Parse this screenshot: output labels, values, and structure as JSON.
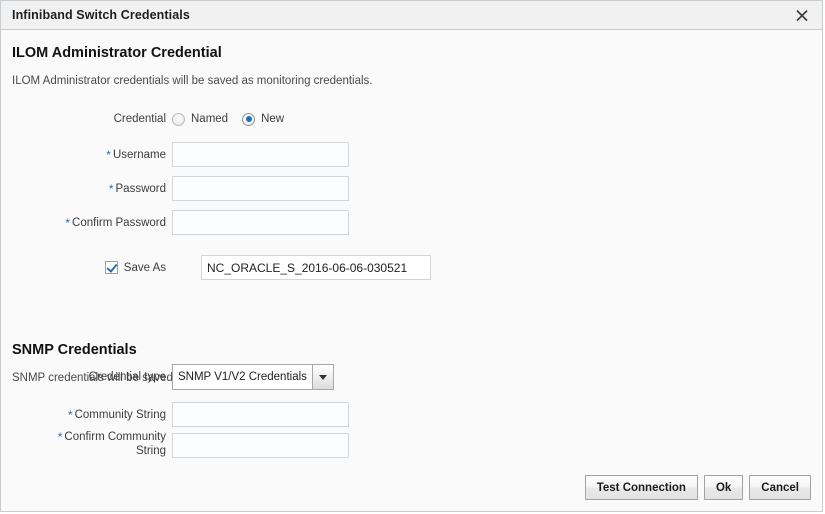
{
  "dialog": {
    "title": "Infiniband Switch Credentials",
    "close_icon": "close-icon"
  },
  "ilom": {
    "heading": "ILOM Administrator Credential",
    "description": "ILOM Administrator credentials will be saved as monitoring credentials.",
    "credential_label": "Credential",
    "radio_named": "Named",
    "radio_new": "New",
    "selected_credential": "New",
    "username_label": "Username",
    "username_value": "",
    "password_label": "Password",
    "password_value": "",
    "confirm_password_label": "Confirm Password",
    "confirm_password_value": "",
    "save_as_label": "Save As",
    "save_as_checked": true,
    "save_as_value": "NC_ORACLE_S_2016-06-06-030521",
    "required_marker": "*"
  },
  "snmp": {
    "heading": "SNMP Credentials",
    "description": "SNMP credentials will be saved as monitoring credentials.",
    "credential_type_label": "Credential type",
    "credential_type_value": "SNMP V1/V2 Credentials",
    "community_string_label": "Community String",
    "community_string_value": "",
    "confirm_community_string_label_line1": "Confirm Community",
    "confirm_community_string_label_line2": "String",
    "confirm_community_string_value": "",
    "required_marker": "*"
  },
  "footer": {
    "test_connection": "Test Connection",
    "ok": "Ok",
    "cancel": "Cancel"
  },
  "colors": {
    "accent": "#1e6fb8",
    "required": "#2f6fb5",
    "titlebar_bg": "#f1f1f1",
    "body_bg": "#fafafa",
    "border": "#c8cdd2"
  }
}
